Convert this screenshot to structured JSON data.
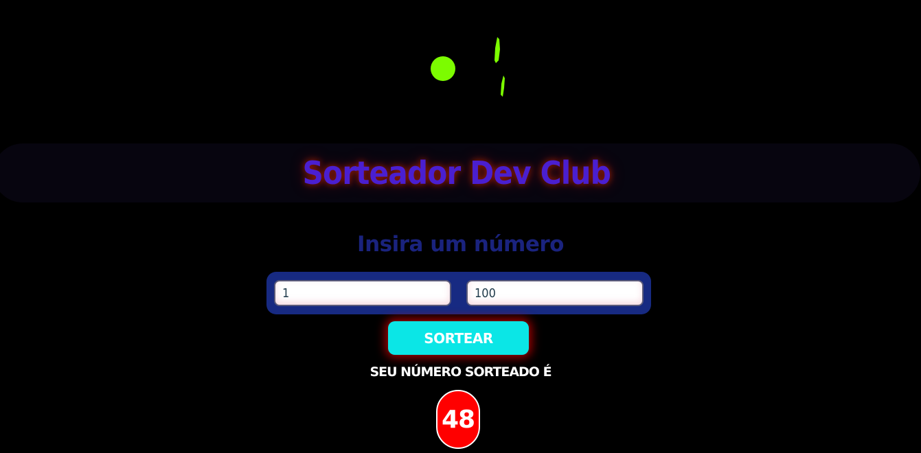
{
  "header": {
    "title": "Sorteador Dev Club",
    "logo_icon": "green-dot-and-dashes-logo",
    "logo_color": "#7cfc00"
  },
  "main": {
    "prompt": "Insira um número",
    "min_input": {
      "value": "1"
    },
    "max_input": {
      "value": "100"
    },
    "draw_button_label": "SORTEAR",
    "result_label": "SEU NÚMERO SORTEADO É",
    "result_value": "48"
  },
  "colors": {
    "background": "#000000",
    "title": "#4a1fd0",
    "prompt": "#1a237e",
    "inputs_box": "#172a82",
    "button": "#0be6e6",
    "button_glow": "#dc0000",
    "result_badge": "#ff0000"
  }
}
